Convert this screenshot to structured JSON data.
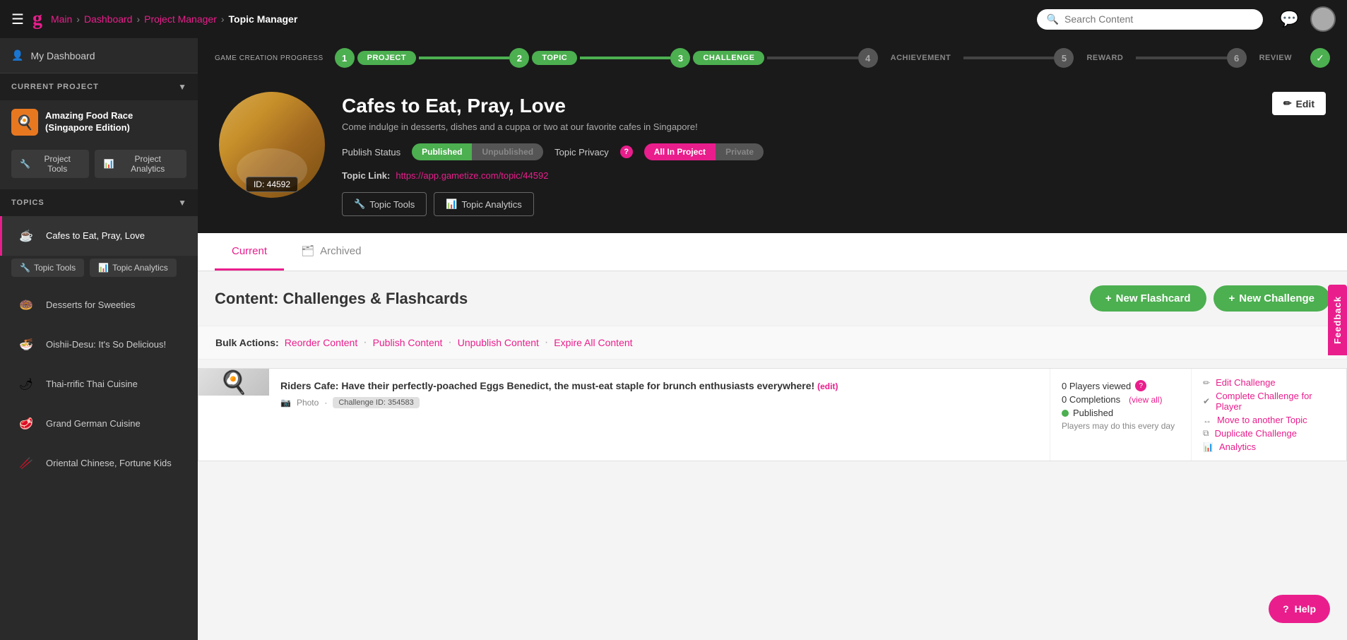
{
  "header": {
    "hamburger": "☰",
    "logo": "g",
    "breadcrumb": [
      {
        "label": "Main",
        "active": false
      },
      {
        "label": "Dashboard",
        "active": false
      },
      {
        "label": "Project Manager",
        "active": false
      },
      {
        "label": "Topic Manager",
        "active": true
      }
    ],
    "search_placeholder": "Search Content",
    "chat_icon": "💬",
    "title": "Topic Manager"
  },
  "sidebar": {
    "my_dashboard": "My Dashboard",
    "current_project_label": "CURRENT PROJECT",
    "project": {
      "name": "Amazing Food Race\n(Singapore Edition)",
      "icon_emoji": "🍳"
    },
    "project_buttons": {
      "tools": "Project Tools",
      "analytics": "Project Analytics"
    },
    "topics_label": "TOPICS",
    "topics": [
      {
        "name": "Cafes to Eat, Pray, Love",
        "emoji": "☕",
        "active": true
      },
      {
        "name": "Desserts for Sweeties",
        "emoji": "🍩",
        "active": false
      },
      {
        "name": "Oishii-Desu: It's So Delicious!",
        "emoji": "🍜",
        "active": false
      },
      {
        "name": "Thai-rrific Thai Cuisine",
        "emoji": "🌶",
        "active": false
      },
      {
        "name": "Grand German Cuisine",
        "emoji": "🥩",
        "active": false
      },
      {
        "name": "Oriental Chinese, Fortune Kids",
        "emoji": "🥢",
        "active": false
      }
    ],
    "active_topic_buttons": {
      "tools": "Topic Tools",
      "analytics": "Topic Analytics"
    }
  },
  "progress": {
    "label": "GAME CREATION\nPROGRESS",
    "steps": [
      {
        "num": "1",
        "label": "PROJECT",
        "active": true
      },
      {
        "num": "2",
        "label": "TOPIC",
        "active": true
      },
      {
        "num": "3",
        "label": "CHALLENGE",
        "active": true
      },
      {
        "num": "4",
        "label": "ACHIEVEMENT",
        "active": false
      },
      {
        "num": "5",
        "label": "REWARD",
        "active": false
      },
      {
        "num": "6",
        "label": "REVIEW",
        "active": false
      }
    ]
  },
  "topic": {
    "title": "Cafes to Eat, Pray, Love",
    "description": "Come indulge in desserts, dishes and a cuppa or two at our favorite cafes in Singapore!",
    "id": "ID: 44592",
    "publish_status_label": "Publish Status",
    "publish_published": "Published",
    "publish_unpublished": "Unpublished",
    "privacy_label": "Topic Privacy",
    "privacy_all": "All In Project",
    "privacy_private": "Private",
    "link_label": "Topic Link:",
    "link_url": "https://app.gametize.com/topic/44592",
    "btn_tools": "Topic Tools",
    "btn_analytics": "Topic Analytics",
    "edit_btn": "Edit",
    "wrench_icon": "🔧",
    "chart_icon": "📊",
    "pencil_icon": "✏"
  },
  "tabs": {
    "current": "Current",
    "archived": "Archived",
    "archive_icon": "🗂"
  },
  "content": {
    "title": "Content: Challenges & Flashcards",
    "btn_new_flashcard": "New Flashcard",
    "btn_new_challenge": "New Challenge",
    "plus_icon": "+",
    "bulk_actions_label": "Bulk Actions:",
    "bulk_reorder": "Reorder Content",
    "bulk_publish": "Publish Content",
    "bulk_unpublish": "Unpublish Content",
    "bulk_expire": "Expire All Content"
  },
  "challenge": {
    "title": "Riders Cafe: Have their perfectly-poached Eggs Benedict, the must-eat staple for brunch enthusiasts everywhere!",
    "edit_link": "(edit)",
    "type": "Photo",
    "id_badge": "Challenge ID: 354583",
    "players_viewed": "0 Players viewed",
    "completions": "0 Completions",
    "view_all": "(view all)",
    "status": "Published",
    "status_note": "Players may do this every day",
    "actions": [
      "Edit Challenge",
      "Complete Challenge for Player",
      "Move to another Topic",
      "Duplicate Challenge",
      "Analytics"
    ]
  },
  "feedback_tab": "Feedback",
  "help_btn": "Help"
}
